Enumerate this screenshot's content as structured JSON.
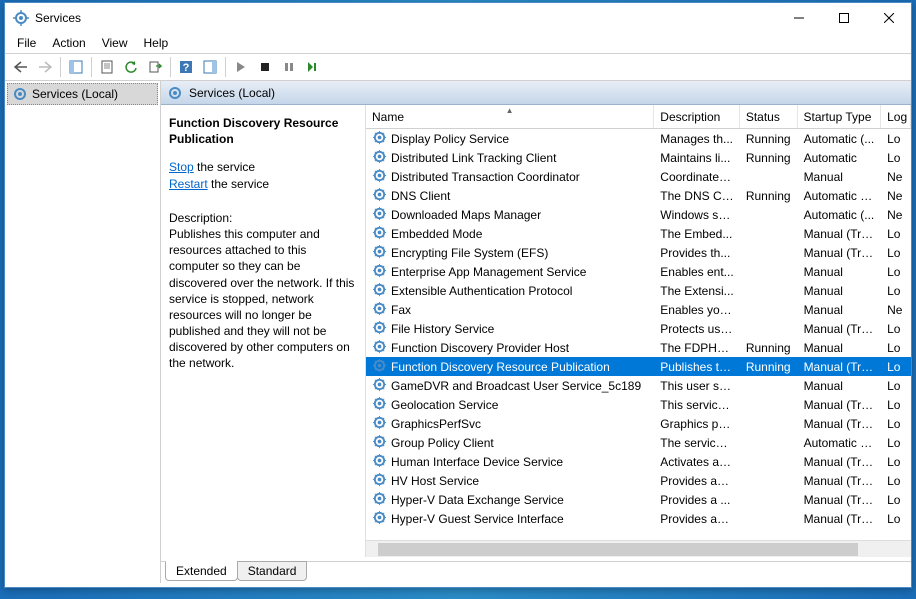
{
  "window": {
    "title": "Services"
  },
  "menu": {
    "file": "File",
    "action": "Action",
    "view": "View",
    "help": "Help"
  },
  "tree": {
    "root": "Services (Local)"
  },
  "right_header": "Services (Local)",
  "detail": {
    "name": "Function Discovery Resource Publication",
    "stop_label": "Stop",
    "stop_suffix": " the service",
    "restart_label": "Restart",
    "restart_suffix": " the service",
    "desc_label": "Description:",
    "desc_text": "Publishes this computer and resources attached to this computer so they can be discovered over the network.  If this service is stopped, network resources will no longer be published and they will not be discovered by other computers on the network."
  },
  "columns": {
    "name": "Name",
    "desc": "Description",
    "status": "Status",
    "startup": "Startup Type",
    "logon": "Log On As"
  },
  "rows": [
    {
      "name": "Display Policy Service",
      "desc": "Manages th...",
      "status": "Running",
      "startup": "Automatic (...",
      "logon": "Lo"
    },
    {
      "name": "Distributed Link Tracking Client",
      "desc": "Maintains li...",
      "status": "Running",
      "startup": "Automatic",
      "logon": "Lo"
    },
    {
      "name": "Distributed Transaction Coordinator",
      "desc": "Coordinates...",
      "status": "",
      "startup": "Manual",
      "logon": "Ne"
    },
    {
      "name": "DNS Client",
      "desc": "The DNS Cli...",
      "status": "Running",
      "startup": "Automatic (T...",
      "logon": "Ne"
    },
    {
      "name": "Downloaded Maps Manager",
      "desc": "Windows se...",
      "status": "",
      "startup": "Automatic (...",
      "logon": "Ne"
    },
    {
      "name": "Embedded Mode",
      "desc": "The Embed...",
      "status": "",
      "startup": "Manual (Trig...",
      "logon": "Lo"
    },
    {
      "name": "Encrypting File System (EFS)",
      "desc": "Provides th...",
      "status": "",
      "startup": "Manual (Trig...",
      "logon": "Lo"
    },
    {
      "name": "Enterprise App Management Service",
      "desc": "Enables ent...",
      "status": "",
      "startup": "Manual",
      "logon": "Lo"
    },
    {
      "name": "Extensible Authentication Protocol",
      "desc": "The Extensi...",
      "status": "",
      "startup": "Manual",
      "logon": "Lo"
    },
    {
      "name": "Fax",
      "desc": "Enables you...",
      "status": "",
      "startup": "Manual",
      "logon": "Ne"
    },
    {
      "name": "File History Service",
      "desc": "Protects use...",
      "status": "",
      "startup": "Manual (Trig...",
      "logon": "Lo"
    },
    {
      "name": "Function Discovery Provider Host",
      "desc": "The FDPHO...",
      "status": "Running",
      "startup": "Manual",
      "logon": "Lo"
    },
    {
      "name": "Function Discovery Resource Publication",
      "desc": "Publishes th...",
      "status": "Running",
      "startup": "Manual (Trig...",
      "logon": "Lo",
      "selected": true
    },
    {
      "name": "GameDVR and Broadcast User Service_5c189",
      "desc": "This user ser...",
      "status": "",
      "startup": "Manual",
      "logon": "Lo"
    },
    {
      "name": "Geolocation Service",
      "desc": "This service ...",
      "status": "",
      "startup": "Manual (Trig...",
      "logon": "Lo"
    },
    {
      "name": "GraphicsPerfSvc",
      "desc": "Graphics pe...",
      "status": "",
      "startup": "Manual (Trig...",
      "logon": "Lo"
    },
    {
      "name": "Group Policy Client",
      "desc": "The service i...",
      "status": "",
      "startup": "Automatic (T...",
      "logon": "Lo"
    },
    {
      "name": "Human Interface Device Service",
      "desc": "Activates an...",
      "status": "",
      "startup": "Manual (Trig...",
      "logon": "Lo"
    },
    {
      "name": "HV Host Service",
      "desc": "Provides an ...",
      "status": "",
      "startup": "Manual (Trig...",
      "logon": "Lo"
    },
    {
      "name": "Hyper-V Data Exchange Service",
      "desc": "Provides a ...",
      "status": "",
      "startup": "Manual (Trig...",
      "logon": "Lo"
    },
    {
      "name": "Hyper-V Guest Service Interface",
      "desc": "Provides an ...",
      "status": "",
      "startup": "Manual (Trig...",
      "logon": "Lo"
    }
  ],
  "tabs": {
    "extended": "Extended",
    "standard": "Standard"
  }
}
